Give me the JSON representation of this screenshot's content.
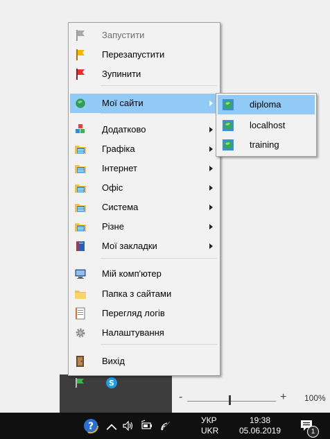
{
  "menu": {
    "items": [
      {
        "label": "Запустити",
        "icon": "flag-gray-icon",
        "disabled": true
      },
      {
        "label": "Перезапустити",
        "icon": "flag-yellow-icon"
      },
      {
        "label": "Зупинити",
        "icon": "flag-red-icon"
      },
      {
        "label": "Мої сайти",
        "icon": "globe-icon",
        "submenu": true,
        "highlighted": true
      },
      {
        "label": "Додатково",
        "icon": "cubes-icon",
        "submenu": true
      },
      {
        "label": "Графіка",
        "icon": "folder-app-icon",
        "submenu": true
      },
      {
        "label": "Інтернет",
        "icon": "folder-app-icon",
        "submenu": true
      },
      {
        "label": "Офіс",
        "icon": "folder-app-icon",
        "submenu": true
      },
      {
        "label": "Система",
        "icon": "folder-app-icon",
        "submenu": true
      },
      {
        "label": "Різне",
        "icon": "folder-app-icon",
        "submenu": true
      },
      {
        "label": "Мої закладки",
        "icon": "bookmark-book-icon",
        "submenu": true
      },
      {
        "label": "Мій комп'ютер",
        "icon": "computer-icon"
      },
      {
        "label": "Папка з сайтами",
        "icon": "folder-icon"
      },
      {
        "label": "Перегляд логів",
        "icon": "log-file-icon"
      },
      {
        "label": "Налаштування",
        "icon": "gear-icon"
      },
      {
        "label": "Вихід",
        "icon": "exit-door-icon"
      }
    ]
  },
  "submenu": {
    "items": [
      {
        "label": "diploma",
        "highlighted": true
      },
      {
        "label": "localhost"
      },
      {
        "label": "training"
      }
    ]
  },
  "zoom": {
    "minus": "-",
    "plus": "+",
    "value": "100%",
    "level": 0.48
  },
  "taskbar": {
    "lang_top": "УКР",
    "lang_bottom": "UKR",
    "time": "19:38",
    "date": "05.06.2019",
    "notification_count": "1",
    "chevron": "^"
  },
  "colors": {
    "highlight": "#91c9f7",
    "taskbar": "#101010",
    "tray_popup": "#3d3d3d"
  }
}
